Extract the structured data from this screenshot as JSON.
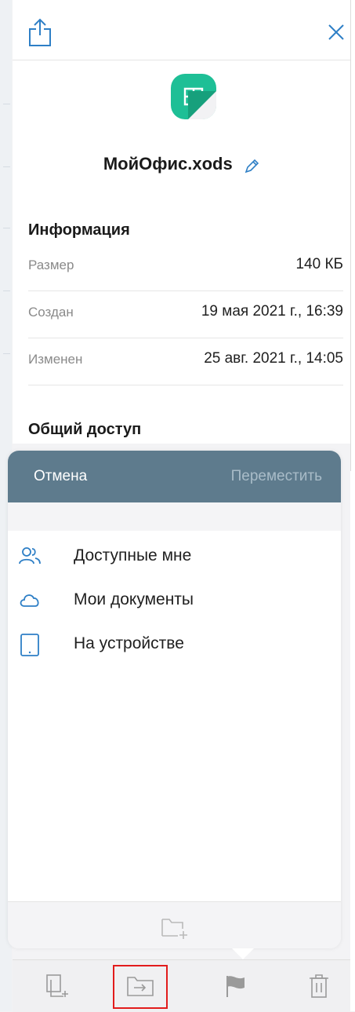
{
  "file": {
    "name": "МойОфис.xods"
  },
  "info": {
    "title": "Информация",
    "rows": [
      {
        "label": "Размер",
        "value": "140 КБ"
      },
      {
        "label": "Создан",
        "value": "19 мая 2021 г., 16:39"
      },
      {
        "label": "Изменен",
        "value": "25 авг. 2021 г., 14:05"
      }
    ]
  },
  "sharing": {
    "title": "Общий доступ"
  },
  "picker": {
    "cancel_label": "Отмена",
    "move_label": "Переместить",
    "locations": [
      {
        "label": "Доступные мне",
        "icon": "shared-users-icon"
      },
      {
        "label": "Мои документы",
        "icon": "cloud-icon"
      },
      {
        "label": "На устройстве",
        "icon": "tablet-icon"
      }
    ],
    "footer_icon": "new-folder-icon"
  },
  "toolbar": {
    "icons": [
      "copy-icon",
      "move-to-folder-icon",
      "flag-icon",
      "trash-icon"
    ],
    "highlighted": "move-to-folder-icon"
  },
  "colors": {
    "accent": "#2e7fc6",
    "app_icon": "#1ebf96",
    "picker_header": "#5e7b8d",
    "highlight": "#e21c1c"
  }
}
